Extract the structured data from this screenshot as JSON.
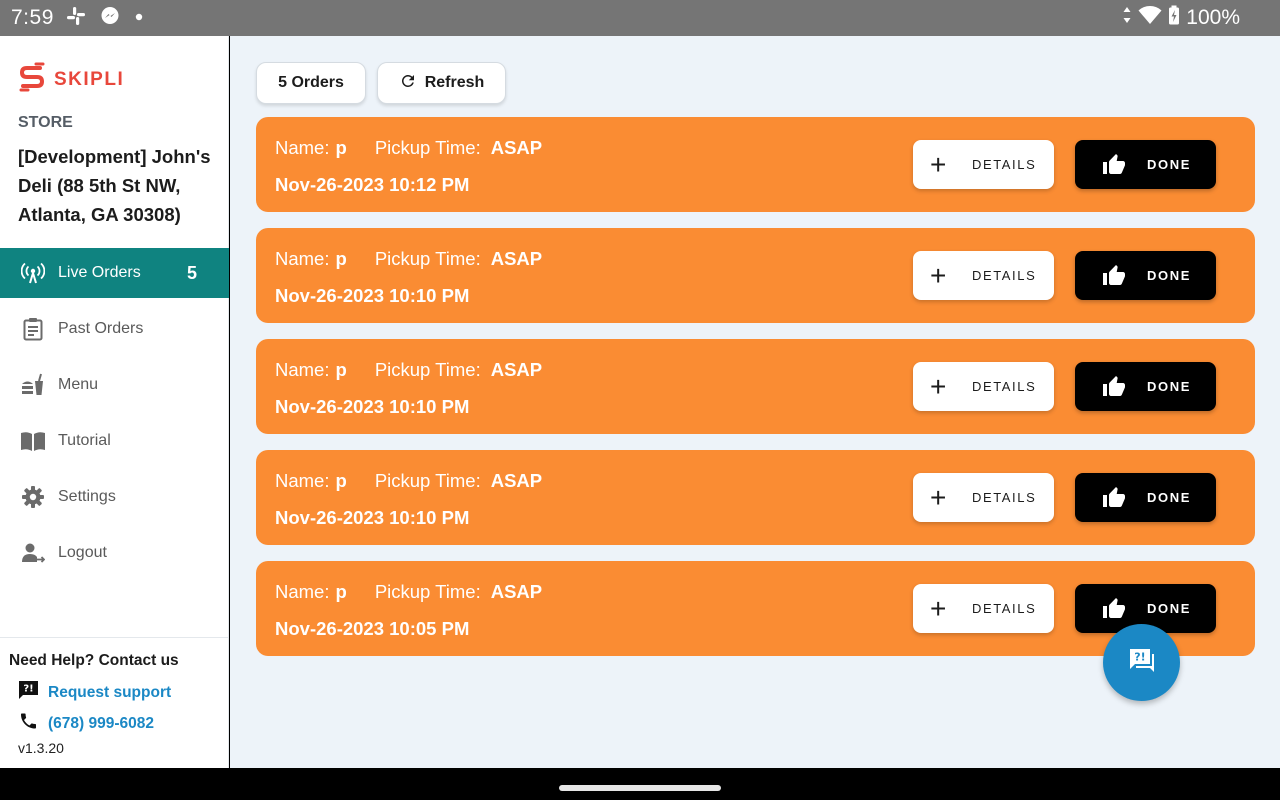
{
  "status_bar": {
    "time": "7:59",
    "left_icons": [
      "slack-icon",
      "messenger-icon",
      "dot-icon"
    ],
    "right_icons": [
      "data-arrows-icon",
      "wifi-icon",
      "battery-charging-icon"
    ],
    "battery": "100%"
  },
  "sidebar": {
    "logo_text": "SKIPLI",
    "store_label": "STORE",
    "store_name": "[Development] John's Deli (88 5th St NW, Atlanta, GA 30308)",
    "nav": {
      "live_orders": {
        "label": "Live Orders",
        "count": "5",
        "icon": "broadcast-icon"
      },
      "past_orders": {
        "label": "Past Orders",
        "icon": "clipboard-icon"
      },
      "menu": {
        "label": "Menu",
        "icon": "food-icon"
      },
      "tutorial": {
        "label": "Tutorial",
        "icon": "book-icon"
      },
      "settings": {
        "label": "Settings",
        "icon": "gear-icon"
      },
      "logout": {
        "label": "Logout",
        "icon": "logout-icon"
      }
    },
    "help": {
      "title": "Need Help? Contact us",
      "request_support": "Request support",
      "phone": "(678) 999-6082",
      "version": "v1.3.20"
    }
  },
  "toolbar": {
    "orders_count_label": "5 Orders",
    "refresh_label": "Refresh"
  },
  "order_labels": {
    "name": "Name:",
    "pickup_time": "Pickup Time:",
    "details": "DETAILS",
    "done": "DONE"
  },
  "orders": [
    {
      "name": "p",
      "pickup_time": "ASAP",
      "datetime": "Nov-26-2023 10:12 PM"
    },
    {
      "name": "p",
      "pickup_time": "ASAP",
      "datetime": "Nov-26-2023 10:10 PM"
    },
    {
      "name": "p",
      "pickup_time": "ASAP",
      "datetime": "Nov-26-2023 10:10 PM"
    },
    {
      "name": "p",
      "pickup_time": "ASAP",
      "datetime": "Nov-26-2023 10:10 PM"
    },
    {
      "name": "p",
      "pickup_time": "ASAP",
      "datetime": "Nov-26-2023 10:05 PM"
    }
  ],
  "colors": {
    "brand_red": "#e8473b",
    "active_nav": "#0f8380",
    "order_card": "#fa8c33",
    "link_blue": "#1b88c5",
    "main_bg": "#edf3f9"
  }
}
